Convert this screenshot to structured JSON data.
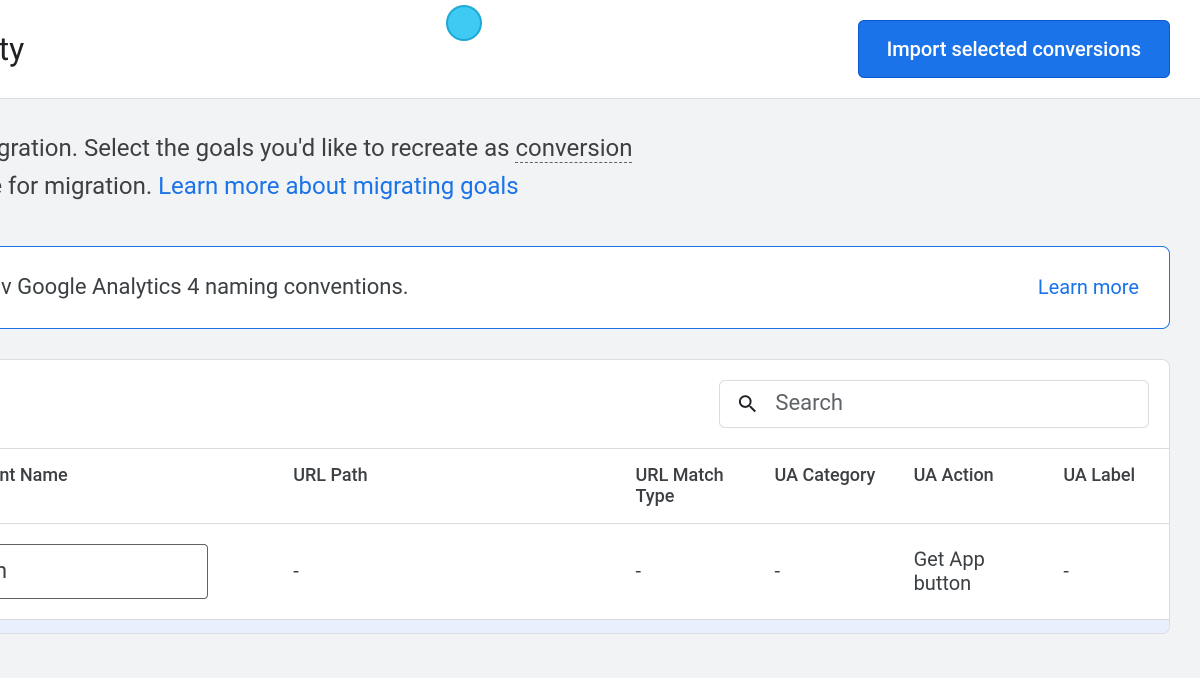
{
  "header": {
    "title_fragment": "erty",
    "import_button": "Import selected conversions"
  },
  "description": {
    "line1_prefix": " migration. Select the goals you'd like to recreate as ",
    "conversion_word": "conversion",
    "line2_prefix": "ble for migration. ",
    "learn_more_link": "Learn more about migrating goals"
  },
  "banner": {
    "text": "v Google Analytics 4 naming conventions.",
    "link": "Learn more"
  },
  "search": {
    "placeholder": "Search"
  },
  "table": {
    "headers": {
      "event_name": "Event Name",
      "url_path": "URL Path",
      "url_match_type": "URL Match Type",
      "ua_category": "UA Category",
      "ua_action": "UA Action",
      "ua_label": "UA Label"
    },
    "rows": [
      {
        "event_name": "utton",
        "url_path": "-",
        "url_match_type": "-",
        "ua_category": "-",
        "ua_action": "Get App button",
        "ua_label": "-"
      }
    ]
  }
}
